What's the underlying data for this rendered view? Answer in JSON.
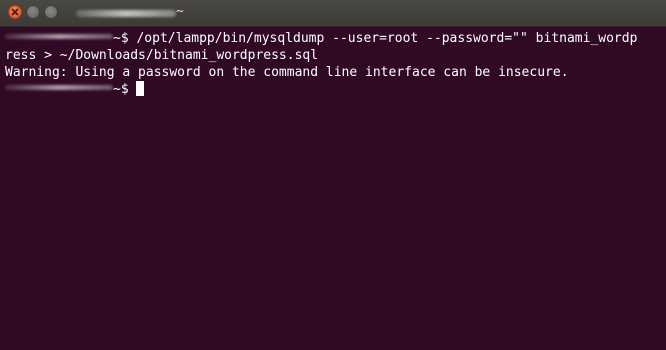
{
  "window": {
    "title": "~"
  },
  "terminal": {
    "lines": [
      {
        "prompt": "~$ ",
        "command": "/opt/lampp/bin/mysqldump --user=root --password=\"\" bitnami_wordp"
      },
      {
        "text": "ress > ~/Downloads/bitnami_wordpress.sql"
      },
      {
        "text": "Warning: Using a password on the command line interface can be insecure."
      },
      {
        "prompt": "~$ "
      }
    ]
  },
  "colors": {
    "terminal_background": "#300a24",
    "titlebar": "#3c3b37",
    "text": "#ffffff",
    "close_button": "#df4b16"
  },
  "icons": {
    "close": "close-icon",
    "minimize": "minimize-icon",
    "maximize": "maximize-icon"
  }
}
